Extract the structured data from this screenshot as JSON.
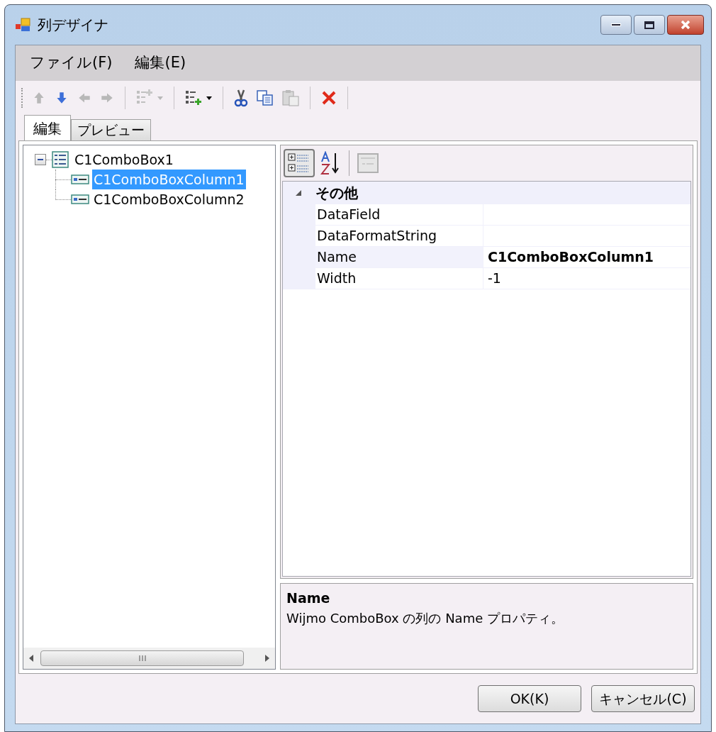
{
  "window": {
    "title": "列デザイナ"
  },
  "menu": [
    "ファイル(F)",
    "編集(E)"
  ],
  "toolbar": [
    {
      "kind": "up",
      "disabled": true
    },
    {
      "kind": "down",
      "disabled": false
    },
    {
      "kind": "left",
      "disabled": true
    },
    {
      "kind": "right",
      "disabled": true
    },
    {
      "kind": "separator"
    },
    {
      "kind": "insert",
      "disabled": true,
      "dropdown": true
    },
    {
      "kind": "separator"
    },
    {
      "kind": "add",
      "disabled": false,
      "dropdown": true
    },
    {
      "kind": "separator"
    },
    {
      "kind": "cut",
      "disabled": false
    },
    {
      "kind": "copy",
      "disabled": false
    },
    {
      "kind": "paste",
      "disabled": true
    },
    {
      "kind": "separator"
    },
    {
      "kind": "delete",
      "disabled": false
    },
    {
      "kind": "separator"
    }
  ],
  "tabs": [
    {
      "label": "編集",
      "selected": true
    },
    {
      "label": "プレビュー",
      "selected": false
    }
  ],
  "tree": {
    "label": "C1ComboBox1",
    "expanded": true,
    "selected": false,
    "children": [
      {
        "label": "C1ComboBoxColumn1",
        "selected": true
      },
      {
        "label": "C1ComboBoxColumn2",
        "selected": false
      }
    ]
  },
  "property_toolbar": [
    {
      "kind": "categorized",
      "selected": true
    },
    {
      "kind": "alphabetical",
      "selected": false
    },
    {
      "kind": "separator"
    },
    {
      "kind": "pages",
      "disabled": true
    }
  ],
  "property_grid": {
    "category": "その他",
    "expanded": true,
    "rows": [
      {
        "name": "DataField",
        "value": "",
        "modified": false,
        "selected": false
      },
      {
        "name": "DataFormatString",
        "value": "",
        "modified": false,
        "selected": false
      },
      {
        "name": "Name",
        "value": "C1ComboBoxColumn1",
        "modified": true,
        "selected": true
      },
      {
        "name": "Width",
        "value": "-1",
        "modified": false,
        "selected": false
      }
    ]
  },
  "description": {
    "title": "Name",
    "text": "Wijmo ComboBox の列の Name プロパティ。"
  },
  "buttons": [
    "OK(K)",
    "キャンセル(C)"
  ]
}
